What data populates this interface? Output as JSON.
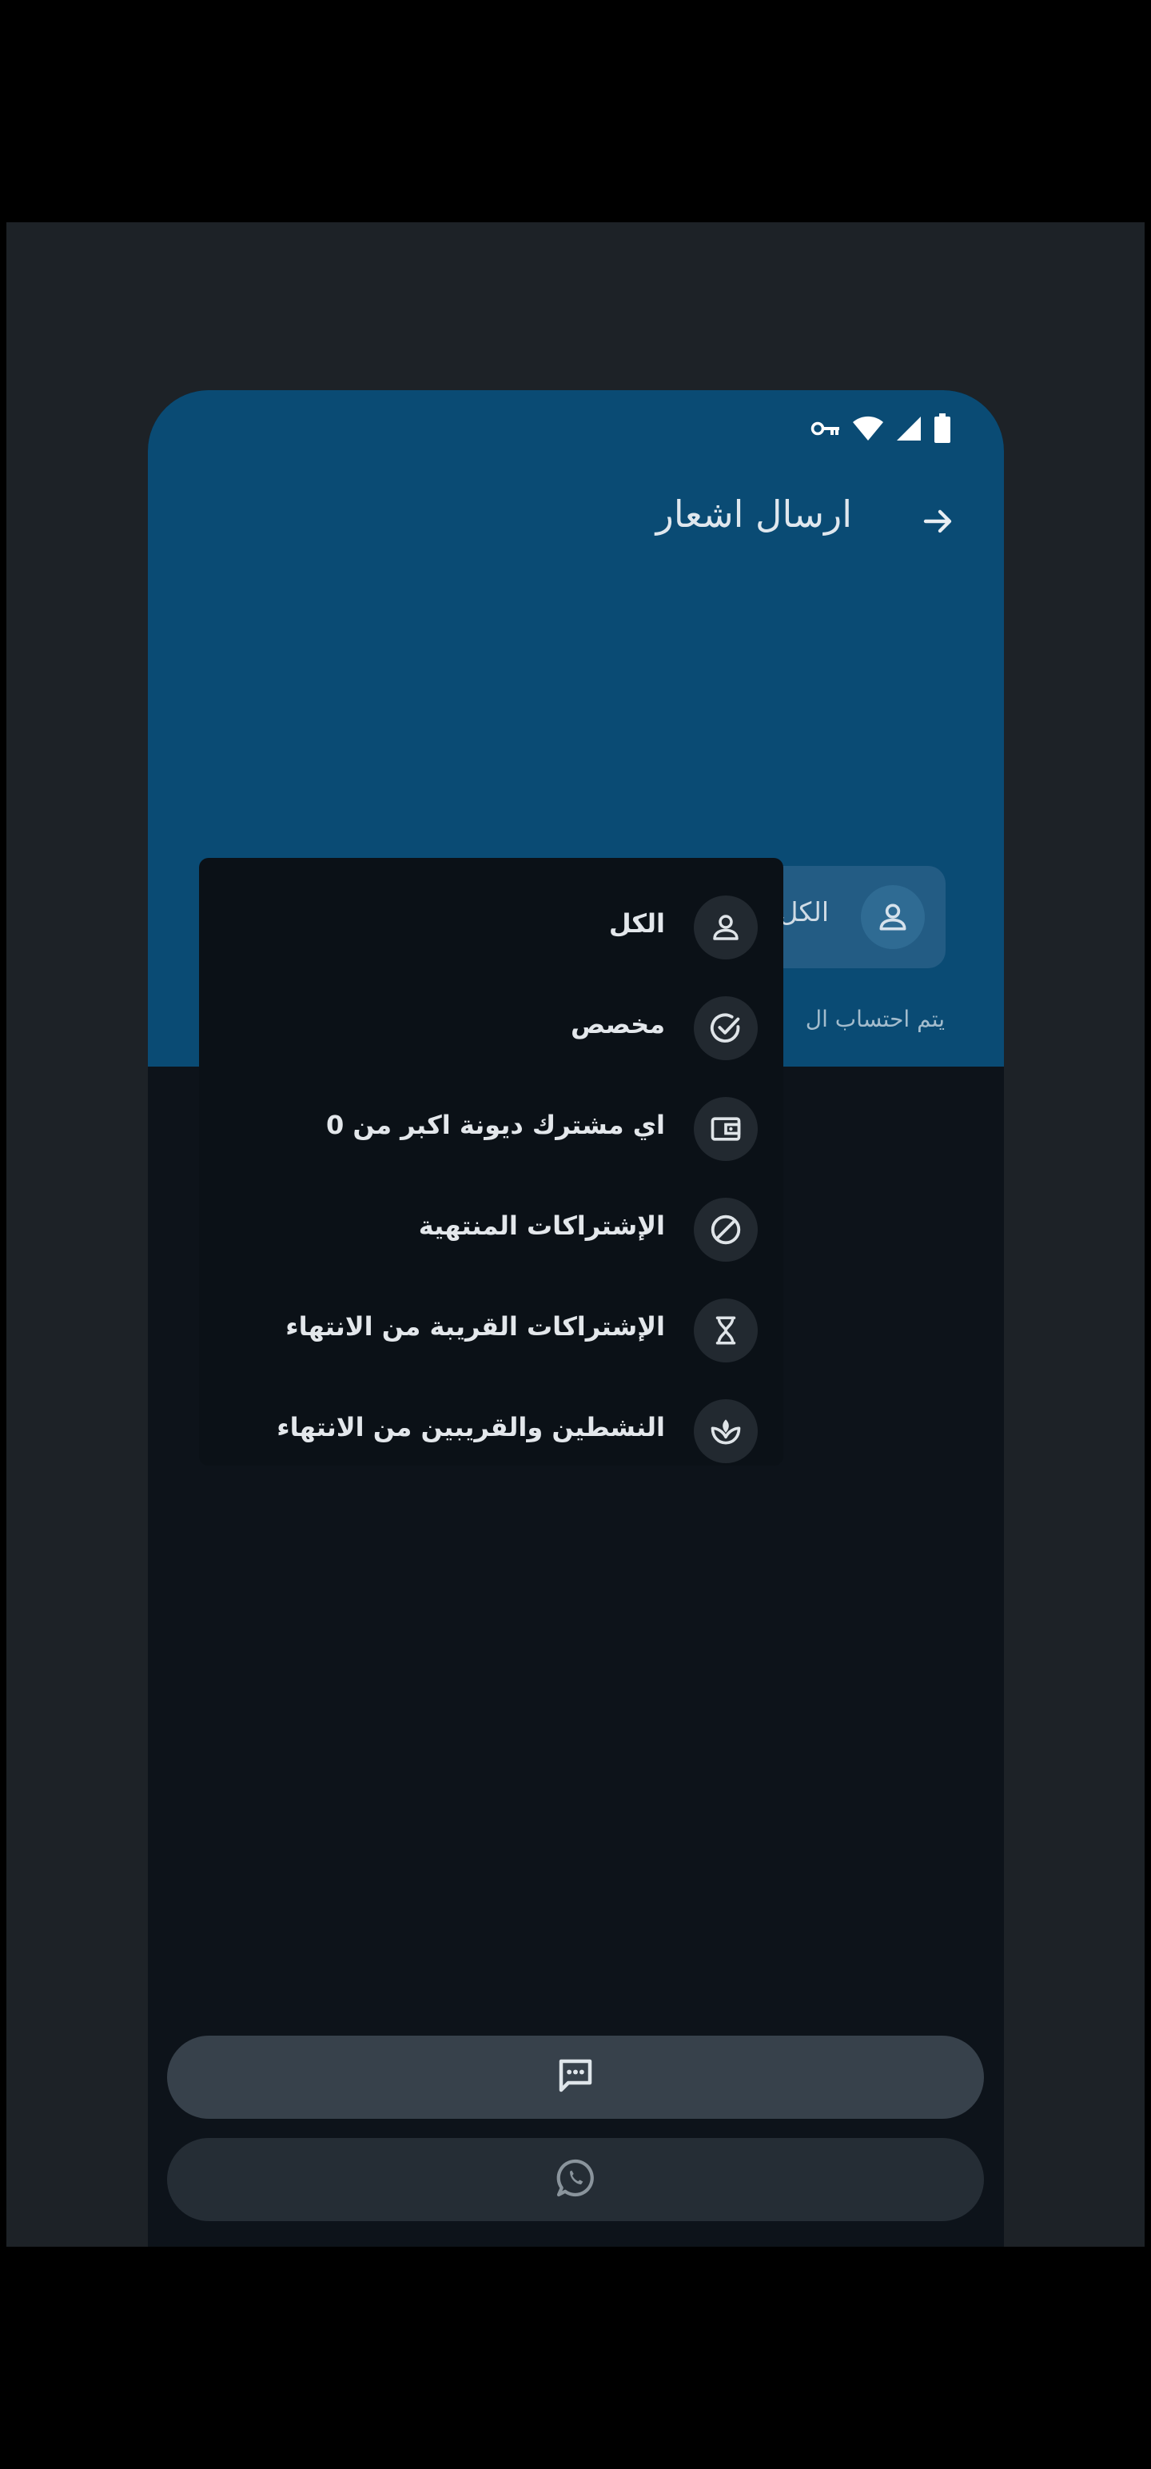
{
  "header": {
    "title": "ارسال اشعار",
    "back_icon": "arrow-right-icon"
  },
  "status_bar": {
    "icons": [
      "vpn-key-icon",
      "wifi-icon",
      "signal-icon",
      "battery-icon"
    ]
  },
  "recipient_field": {
    "label": "الكل",
    "icon": "person-icon"
  },
  "helper_text": "يتم احتساب ال",
  "menu": {
    "items": [
      {
        "label": "الكل",
        "icon": "person-icon"
      },
      {
        "label": "مخصص",
        "icon": "check-circle-icon"
      },
      {
        "label": "اي مشترك ديونة اكبر من 0",
        "icon": "wallet-icon"
      },
      {
        "label": "الإشتراكات المنتهية",
        "icon": "block-icon"
      },
      {
        "label": "الإشتراكات القريبة من الانتهاء",
        "icon": "hourglass-icon"
      },
      {
        "label": "النشطين والقريبين من الانتهاء",
        "icon": "spa-icon"
      }
    ]
  },
  "buttons": {
    "sms_icon": "message-icon",
    "whatsapp_icon": "whatsapp-icon"
  },
  "colors": {
    "header_blue": "#0a4b74",
    "background": "#0d131a",
    "menu_background": "#0b1117"
  }
}
